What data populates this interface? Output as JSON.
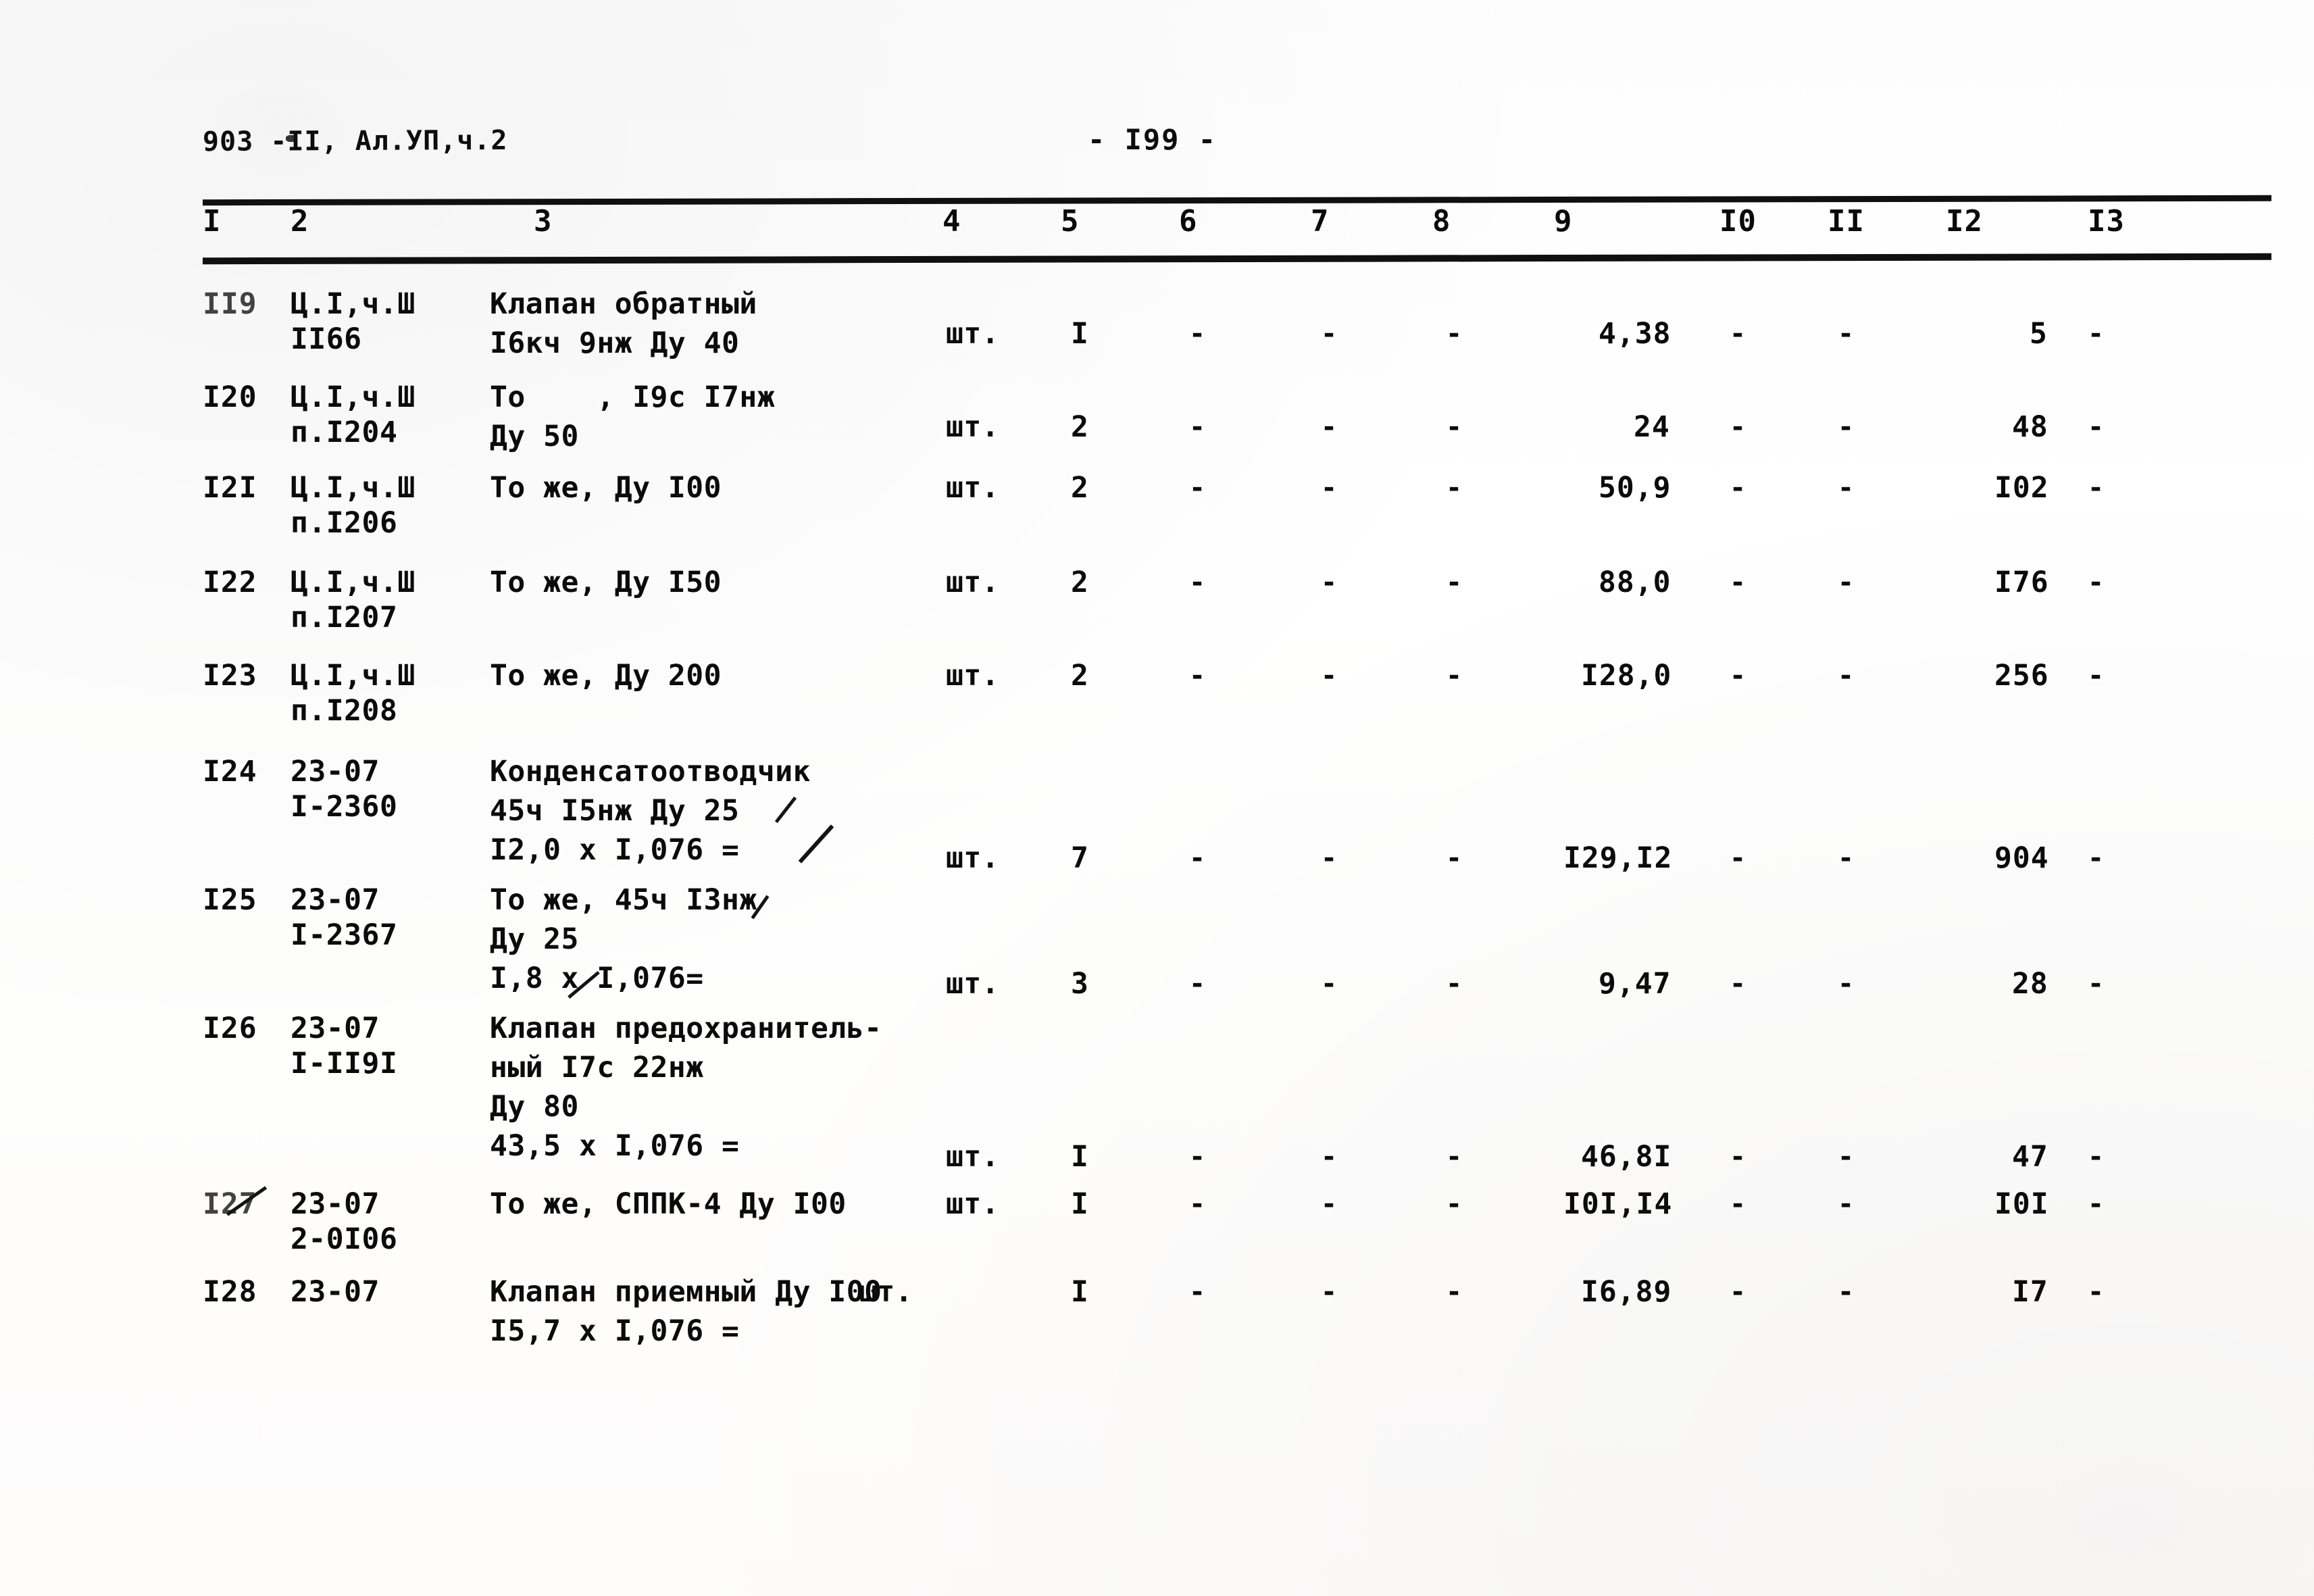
{
  "document": {
    "header_left": "903 -II, Ал.УП,ч.2",
    "page_label": "- I99 -"
  },
  "table": {
    "column_headers": [
      "I",
      "2",
      "3",
      "4",
      "5",
      "6",
      "7",
      "8",
      "9",
      "I0",
      "II",
      "I2",
      "I3"
    ],
    "rows": [
      {
        "c1": "II9",
        "c2": [
          "Ц.I,ч.Ш",
          "II66"
        ],
        "c3": [
          "Клапан обратный",
          "I6кч 9нж Ду 40"
        ],
        "c4": "шт.",
        "c5": "I",
        "c6": "-",
        "c7": "-",
        "c8": "-",
        "c9": "4,38",
        "c10": "-",
        "c11": "-",
        "c12": "5",
        "c13": "-"
      },
      {
        "c1": "I20",
        "c2": [
          "Ц.I,ч.Ш",
          "п.I204"
        ],
        "c3": [
          "То    , I9c I7нж",
          "Ду 50"
        ],
        "c4": "шт.",
        "c5": "2",
        "c6": "-",
        "c7": "-",
        "c8": "-",
        "c9": "24",
        "c10": "-",
        "c11": "-",
        "c12": "48",
        "c13": "-"
      },
      {
        "c1": "I2I",
        "c2": [
          "Ц.I,ч.Ш",
          "п.I206"
        ],
        "c3": [
          "То же, Ду I00"
        ],
        "c4": "шт.",
        "c5": "2",
        "c6": "-",
        "c7": "-",
        "c8": "-",
        "c9": "50,9",
        "c10": "-",
        "c11": "-",
        "c12": "I02",
        "c13": "-"
      },
      {
        "c1": "I22",
        "c2": [
          "Ц.I,ч.Ш",
          "п.I207"
        ],
        "c3": [
          "То же, Ду I50"
        ],
        "c4": "шт.",
        "c5": "2",
        "c6": "-",
        "c7": "-",
        "c8": "-",
        "c9": "88,0",
        "c10": "-",
        "c11": "-",
        "c12": "I76",
        "c13": "-"
      },
      {
        "c1": "I23",
        "c2": [
          "Ц.I,ч.Ш",
          "п.I208"
        ],
        "c3": [
          "То же, Ду 200"
        ],
        "c4": "шт.",
        "c5": "2",
        "c6": "-",
        "c7": "-",
        "c8": "-",
        "c9": "I28,0",
        "c10": "-",
        "c11": "-",
        "c12": "256",
        "c13": "-"
      },
      {
        "c1": "I24",
        "c2": [
          "23-07",
          "I-2360"
        ],
        "c3": [
          "Конденсатоотводчик",
          "45ч I5нж Ду 25",
          "I2,0 x I,076 ="
        ],
        "c4": "шт.",
        "c5": "7",
        "c6": "-",
        "c7": "-",
        "c8": "-",
        "c9": "I29,I2",
        "c10": "-",
        "c11": "-",
        "c12": "904",
        "c13": "-"
      },
      {
        "c1": "I25",
        "c2": [
          "23-07",
          "I-2367"
        ],
        "c3": [
          "То же, 45ч I3нж",
          "Ду 25",
          "I,8 x I,076="
        ],
        "c4": "шт.",
        "c5": "3",
        "c6": "-",
        "c7": "-",
        "c8": "-",
        "c9": "9,47",
        "c10": "-",
        "c11": "-",
        "c12": "28",
        "c13": "-"
      },
      {
        "c1": "I26",
        "c2": [
          "23-07",
          "I-II9I"
        ],
        "c3": [
          "Клапан предохранитель-",
          "ный I7с 22нж",
          "Ду 80",
          "43,5 x I,076 ="
        ],
        "c4": "шт.",
        "c5": "I",
        "c6": "-",
        "c7": "-",
        "c8": "-",
        "c9": "46,8I",
        "c10": "-",
        "c11": "-",
        "c12": "47",
        "c13": "-"
      },
      {
        "c1": "I27",
        "c2": [
          "23-07",
          "2-0I06"
        ],
        "c3": [
          "То же, СППК-4 Ду I00"
        ],
        "c4": "шт.",
        "c5": "I",
        "c6": "-",
        "c7": "-",
        "c8": "-",
        "c9": "I0I,I4",
        "c10": "-",
        "c11": "-",
        "c12": "I0I",
        "c13": "-"
      },
      {
        "c1": "I28",
        "c2": [
          "23-07"
        ],
        "c3": [
          "Клапан приемный Ду I00",
          "I5,7 x I,076 ="
        ],
        "c4": "шт.",
        "c5": "I",
        "c6": "-",
        "c7": "-",
        "c8": "-",
        "c9": "I6,89",
        "c10": "-",
        "c11": "-",
        "c12": "I7",
        "c13": "-"
      }
    ]
  }
}
